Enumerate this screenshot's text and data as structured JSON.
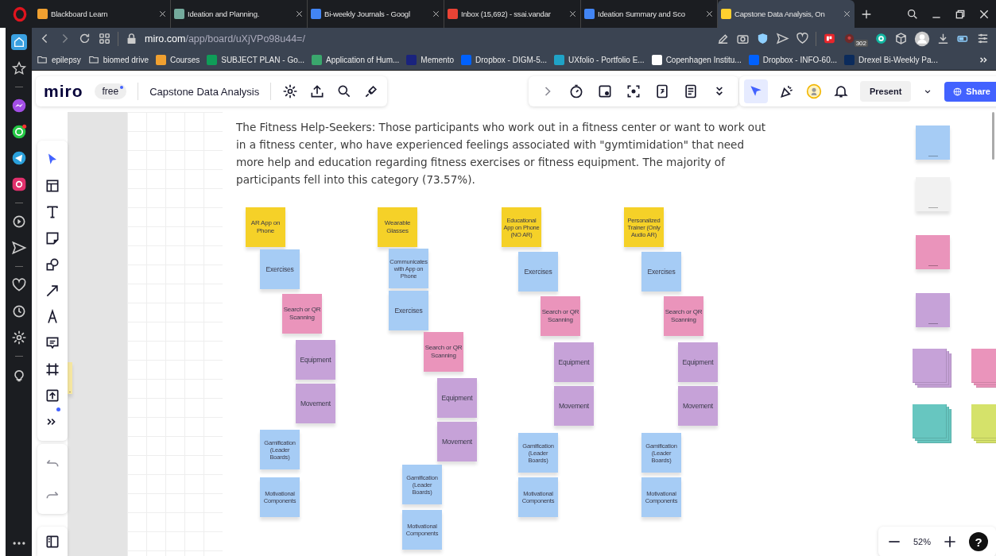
{
  "browser": {
    "tabs": [
      {
        "title": "Blackboard Learn",
        "selected": false,
        "color": "#f0a030"
      },
      {
        "title": "Ideation and Planning.",
        "selected": false,
        "color": "#74aa9c"
      },
      {
        "title": "Bi-weekly Journals - Googl",
        "selected": false,
        "color": "#4285f4"
      },
      {
        "title": "Inbox (15,692) - ssai.vandar",
        "selected": false,
        "color": "#ea4335"
      },
      {
        "title": "Ideation Summary and Sco",
        "selected": false,
        "color": "#4285f4"
      },
      {
        "title": "Capstone Data Analysis, On",
        "selected": true,
        "color": "#ffd02f"
      }
    ],
    "address": {
      "host": "miro.com",
      "path": "/app/board/uXjVPo98u44=/"
    },
    "extension_badge": "302",
    "bookmarks": [
      {
        "label": "epilepsy",
        "kind": "folder"
      },
      {
        "label": "biomed drive",
        "kind": "folder"
      },
      {
        "label": "Courses",
        "kind": "site",
        "color": "#f0a030"
      },
      {
        "label": "SUBJECT PLAN - Go...",
        "kind": "site",
        "color": "#0f9d58"
      },
      {
        "label": "Application of Hum...",
        "kind": "site",
        "color": "#3aa76d"
      },
      {
        "label": "Memento",
        "kind": "site",
        "color": "#1a237e"
      },
      {
        "label": "Dropbox - DIGM-5...",
        "kind": "site",
        "color": "#0061fe"
      },
      {
        "label": "UXfolio - Portfolio E...",
        "kind": "site",
        "color": "#1fa3c7"
      },
      {
        "label": "Copenhagen Institu...",
        "kind": "site",
        "color": "#ffffff"
      },
      {
        "label": "Dropbox - INFO-60...",
        "kind": "site",
        "color": "#0061fe"
      },
      {
        "label": "Drexel Bi-Weekly Pa...",
        "kind": "site",
        "color": "#0b2b5c"
      }
    ]
  },
  "miro": {
    "logo": "miro",
    "plan": "free",
    "board_title": "Capstone Data Analysis",
    "present": "Present",
    "share": "Share",
    "zoom": "52%",
    "help": "?"
  },
  "canvas": {
    "description": "The Fitness Help-Seekers: Those participants who work out in a fitness center or want to work out in a fitness center, who have experienced feelings associated with \"gymtimidation\" that need more help and education regarding fitness exercises or fitness equipment. The majority of participants fell into this category (73.57%).",
    "columns": [
      {
        "notes": [
          {
            "text": "AR App on Phone",
            "color": "#f5d128"
          },
          {
            "text": "Exercises",
            "color": "#a6ccf5"
          },
          {
            "text": "Search or QR Scanning",
            "color": "#ea94bb"
          },
          {
            "text": "Equipment",
            "color": "#c6a2d8"
          },
          {
            "text": "Movement",
            "color": "#c6a2d8"
          },
          {
            "text": "Gamification (Leader Boards)",
            "color": "#a6ccf5"
          },
          {
            "text": "Motivational Components",
            "color": "#a6ccf5"
          }
        ]
      },
      {
        "notes": [
          {
            "text": "Wearable Glasses",
            "color": "#f5d128"
          },
          {
            "text": "Communicates with App on Phone",
            "color": "#a6ccf5"
          },
          {
            "text": "Exercises",
            "color": "#a6ccf5"
          },
          {
            "text": "Search or QR Scanning",
            "color": "#ea94bb"
          },
          {
            "text": "Equipment",
            "color": "#c6a2d8"
          },
          {
            "text": "Movement",
            "color": "#c6a2d8"
          },
          {
            "text": "Gamification (Leader Boards)",
            "color": "#a6ccf5"
          },
          {
            "text": "Motivational Components",
            "color": "#a6ccf5"
          }
        ]
      },
      {
        "notes": [
          {
            "text": "Educational App on Phone (NO AR)",
            "color": "#f5d128"
          },
          {
            "text": "Exercises",
            "color": "#a6ccf5"
          },
          {
            "text": "Search or QR Scanning",
            "color": "#ea94bb"
          },
          {
            "text": "Equipment",
            "color": "#c6a2d8"
          },
          {
            "text": "Movement",
            "color": "#c6a2d8"
          },
          {
            "text": "Gamification (Leader Boards)",
            "color": "#a6ccf5"
          },
          {
            "text": "Motivational Components",
            "color": "#a6ccf5"
          }
        ]
      },
      {
        "notes": [
          {
            "text": "Personalized Trainer (Only Audio AR)",
            "color": "#f5d128"
          },
          {
            "text": "Exercises",
            "color": "#a6ccf5"
          },
          {
            "text": "Search or QR Scanning",
            "color": "#ea94bb"
          },
          {
            "text": "Equipment",
            "color": "#c6a2d8"
          },
          {
            "text": "Movement",
            "color": "#c6a2d8"
          },
          {
            "text": "Gamification (Leader Boards)",
            "color": "#a6ccf5"
          },
          {
            "text": "Motivational Components",
            "color": "#a6ccf5"
          }
        ]
      }
    ],
    "side_notes": [
      {
        "color": "#a6ccf5",
        "stacked": false
      },
      {
        "color": "#f1f1f1",
        "stacked": false
      },
      {
        "color": "#ea94bb",
        "stacked": false
      },
      {
        "color": "#c6a2d8",
        "stacked": false
      },
      {
        "color": "#c6a2d8",
        "stacked": true
      },
      {
        "color": "#ea94bb",
        "stacked": true
      },
      {
        "color": "#67c6c0",
        "stacked": true
      },
      {
        "color": "#d5e26a",
        "stacked": true
      },
      {
        "color": "#f5e6a0",
        "stacked": false
      }
    ]
  }
}
